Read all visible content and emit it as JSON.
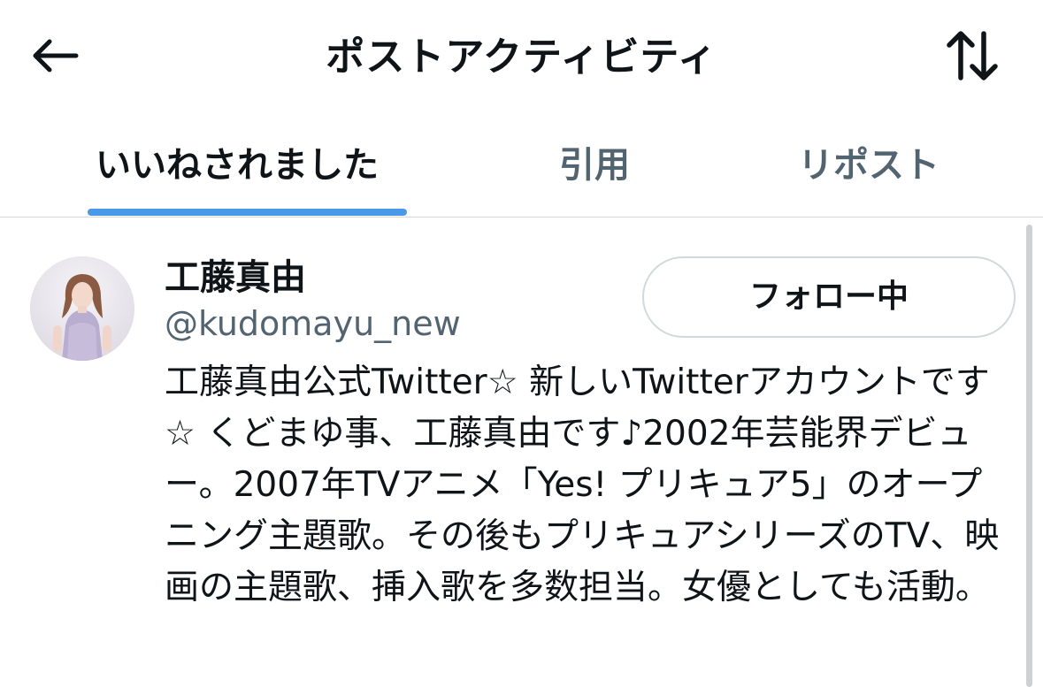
{
  "header": {
    "title": "ポストアクティビティ",
    "back_icon": "arrow-left-icon",
    "sort_icon": "sort-arrows-icon"
  },
  "tabs": [
    {
      "label": "いいねされました",
      "active": true
    },
    {
      "label": "引用",
      "active": false
    },
    {
      "label": "リポスト",
      "active": false
    }
  ],
  "user": {
    "name": "工藤真由",
    "handle": "@kudomayu_new",
    "follow_label": "フォロー中",
    "bio": "工藤真由公式Twitter☆ 新しいTwitterアカウントです☆ くどまゆ事、工藤真由です♪2002年芸能界デビュー。2007年TVアニメ「Yes! プリキュア5」のオープニング主題歌。その後もプリキュアシリーズのTV、映画の主題歌、挿入歌を多数担当。女優としても活動。"
  },
  "colors": {
    "accent": "#4a99e9",
    "text_primary": "#0f1419",
    "text_secondary": "#536471",
    "border": "#cfd9de"
  }
}
